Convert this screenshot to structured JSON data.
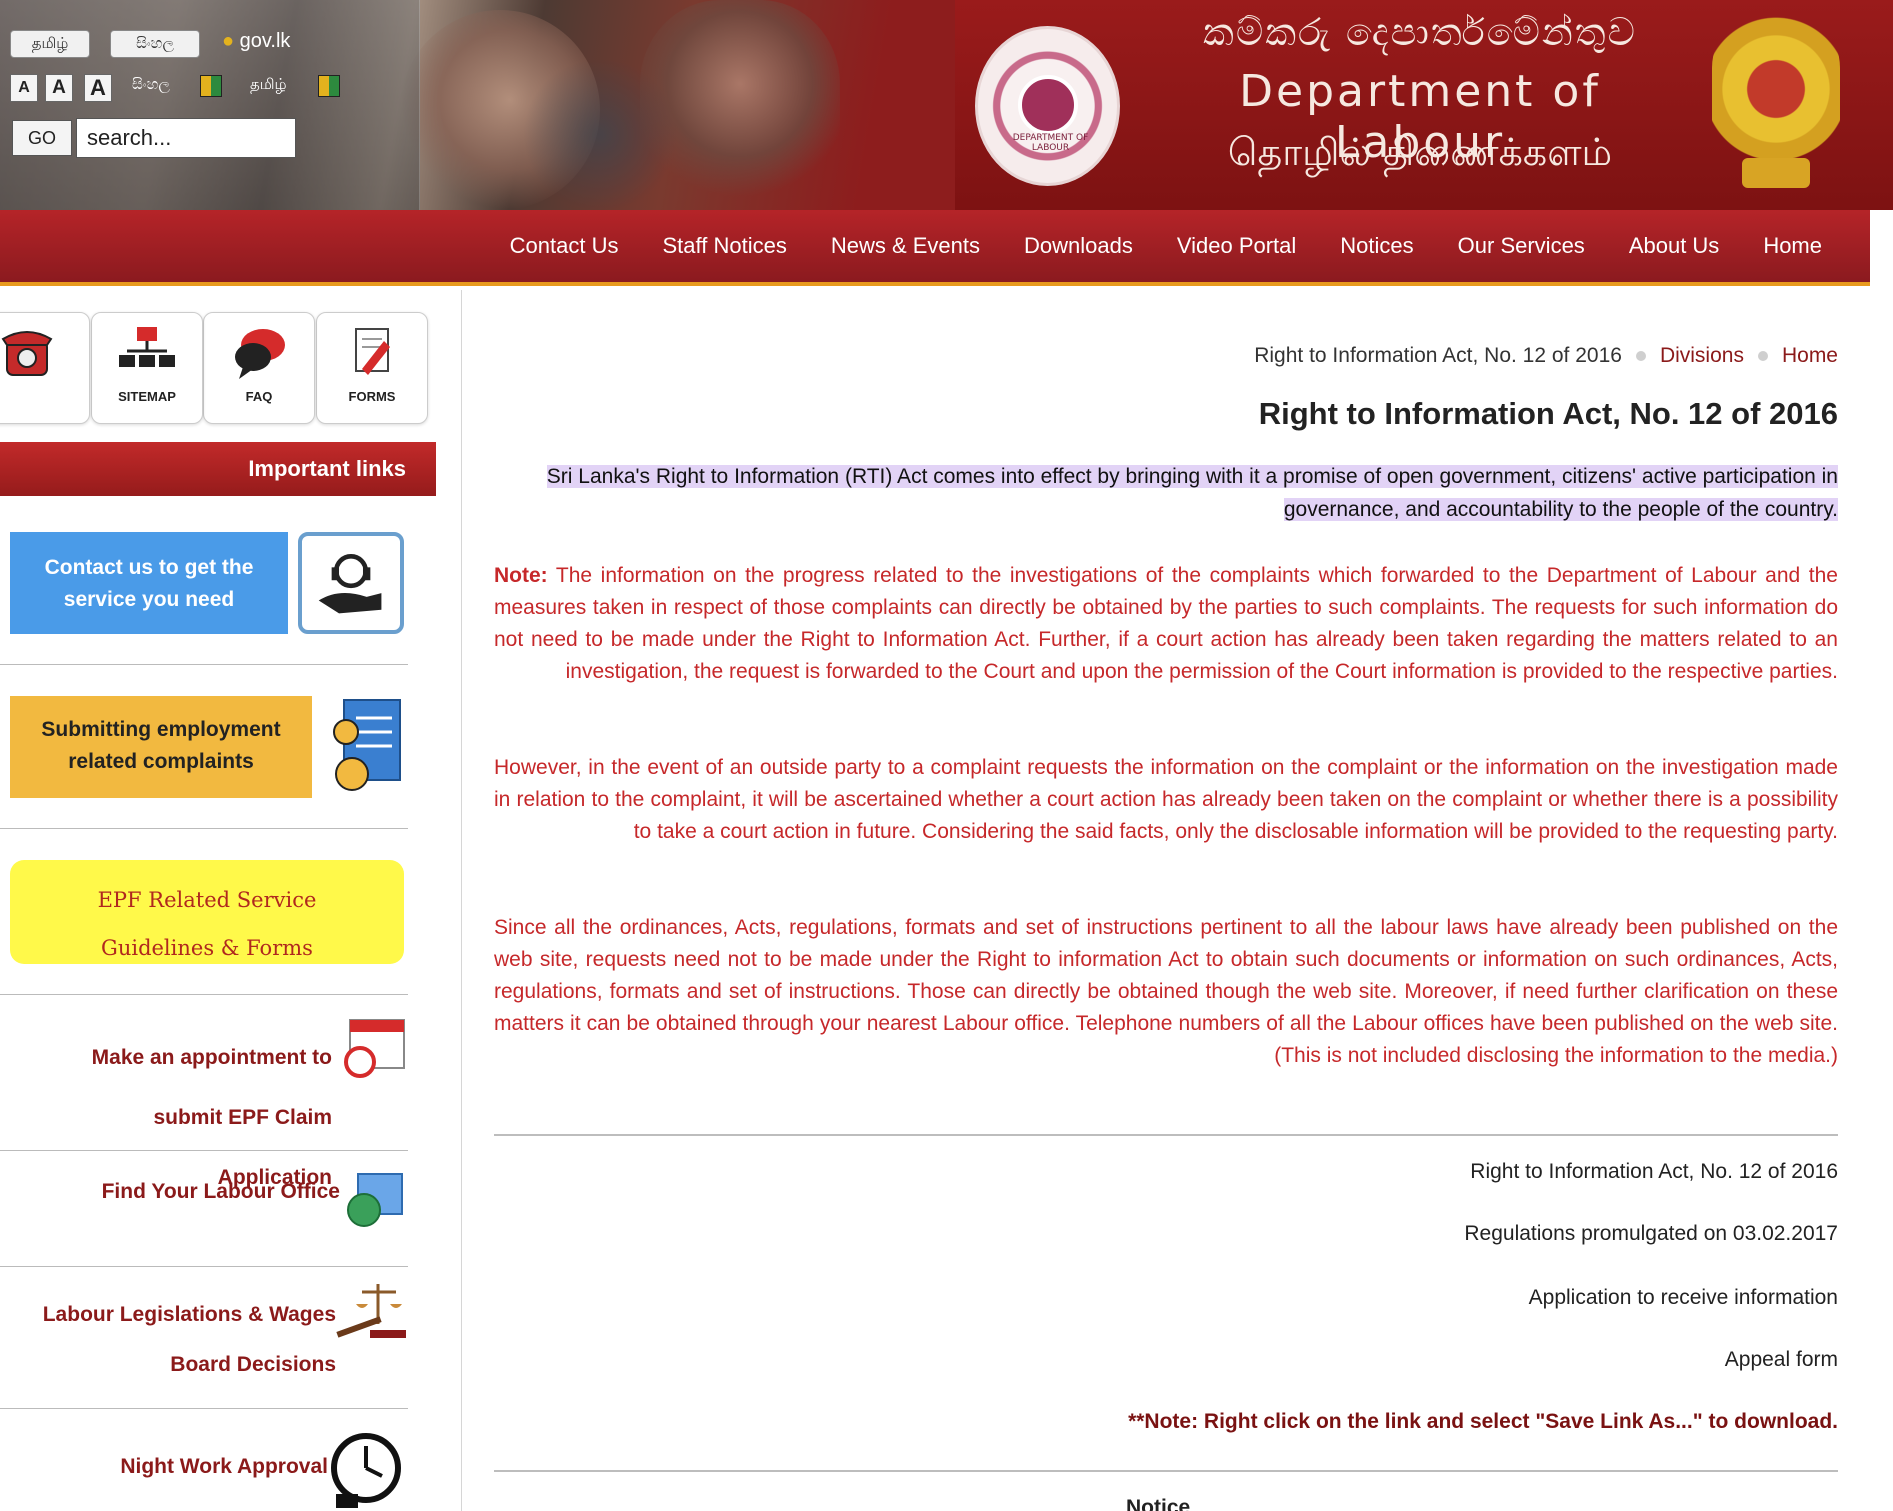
{
  "header": {
    "lang_tamil": "தமிழ்",
    "lang_sinhala": "සිංහල",
    "gov_link": "gov.lk",
    "font_small": "A",
    "font_medium": "A",
    "font_large": "A",
    "lang_link_1": "සිංහල",
    "lang_link_2": "தமிழ்",
    "go_label": "GO",
    "search_placeholder": "search...",
    "title_sinhala": "කම්කරු දෙපාර්තමේන්තුව",
    "title_english": "Department of Labour",
    "title_tamil": "தொழில் திணைக்களம்",
    "seal_caption": "DEPARTMENT OF LABOUR"
  },
  "nav": {
    "items": [
      "Home",
      "About Us",
      "Our Services",
      "Notices",
      "Video Portal",
      "Downloads",
      "News & Events",
      "Staff Notices",
      "Contact Us"
    ]
  },
  "sidebar": {
    "tiles": {
      "forms": "FORMS",
      "faq": "FAQ",
      "sitemap": "SITEMAP"
    },
    "important_heading": "Important links",
    "banner_contact": "Contact us to get the service you need",
    "banner_complaints": "Submitting employment related complaints",
    "banner_epf_line1": "EPF Related Service",
    "banner_epf_line2": "Guidelines & Forms",
    "link_appointment": "Make an appointment to submit EPF Claim Application",
    "link_office": "Find Your Labour Office",
    "link_legislations": "Labour Legislations & Wages Board Decisions",
    "link_night_work": "Night Work Approval"
  },
  "breadcrumb": {
    "home": "Home",
    "divisions": "Divisions",
    "current": "Right to Information Act, No. 12 of 2016"
  },
  "main": {
    "page_title": "Right to Information Act, No. 12 of 2016",
    "intro": "Sri Lanka's Right to Information (RTI) Act comes into effect by bringing with it a promise of open government, citizens' active participation in governance, and accountability to the people of the country.",
    "note_label": "Note:",
    "note_text": " The information on the progress related to the investigations of the complaints which forwarded to the Department of Labour and the measures taken in respect of those complaints can directly be obtained by the parties to such complaints. The requests for such information do not need to be made under the Right to Information Act. Further, if a court action has already been taken regarding the matters related to an investigation, the request is forwarded to the Court and upon the permission of the Court information is provided to the respective parties.",
    "para_outside": "However, in the event of an outside party to a complaint requests the information on the complaint or the information on the investigation made in relation to the complaint, it will be ascertained whether a court action has already been taken on the complaint or whether there is a possibility to take a court action in future. Considering the said facts, only the disclosable information will be provided to the requesting party.",
    "para_since": "Since all the ordinances, Acts, regulations, formats and set of instructions pertinent to all the labour laws have already been published on the web site, requests need not to be made under the Right to information Act to obtain such documents or information on such ordinances, Acts, regulations, formats and set of instructions. Those can directly be obtained though the web site. Moreover, if need further clarification on these matters it can be obtained through your nearest Labour office. Telephone numbers of all the Labour offices have been published on the web site. (This is not included disclosing the information to the media.)",
    "documents": [
      "Right to Information Act, No. 12 of 2016",
      "Regulations promulgated on 03.02.2017",
      "Application to receive information",
      "Appeal form"
    ],
    "download_note": "**Note: Right click on the link and select \"Save Link As...\" to download.",
    "notice_heading": "Notice"
  },
  "colors": {
    "brand_red": "#9a1b1b",
    "accent_orange": "#e89a1e",
    "link_red": "#8b1a1a",
    "body_red": "#c6282a",
    "highlight": "#e2d3f6"
  }
}
